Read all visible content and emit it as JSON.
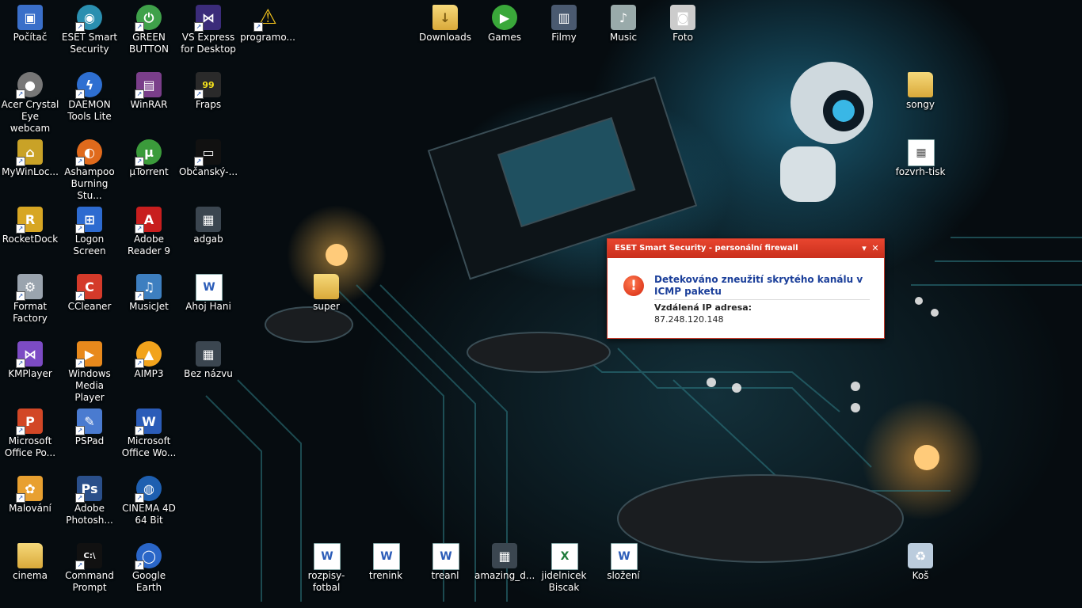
{
  "desktop": {
    "icons": [
      {
        "label": "Počítač",
        "icon": "computer-icon"
      },
      {
        "label": "ESET Smart Security",
        "icon": "eset-icon"
      },
      {
        "label": "GREEN BUTTON",
        "icon": "green-button-icon"
      },
      {
        "label": "VS Express for Desktop",
        "icon": "visual-studio-icon"
      },
      {
        "label": "programo...",
        "icon": "warning-icon"
      },
      {
        "label": "Acer Crystal Eye webcam",
        "icon": "webcam-icon"
      },
      {
        "label": "DAEMON Tools Lite",
        "icon": "daemon-tools-icon"
      },
      {
        "label": "WinRAR",
        "icon": "winrar-icon"
      },
      {
        "label": "Fraps",
        "icon": "fraps-icon"
      },
      {
        "label": "MyWinLoc...",
        "icon": "lock-icon"
      },
      {
        "label": "Ashampoo Burning Stu...",
        "icon": "ashampoo-icon"
      },
      {
        "label": "µTorrent",
        "icon": "utorrent-icon"
      },
      {
        "label": "Občanský-...",
        "icon": "window-icon"
      },
      {
        "label": "RocketDock",
        "icon": "rocketdock-icon"
      },
      {
        "label": "Logon Screen",
        "icon": "logon-screen-icon"
      },
      {
        "label": "Adobe Reader 9",
        "icon": "adobe-reader-icon"
      },
      {
        "label": "adgab",
        "icon": "image-icon"
      },
      {
        "label": "Format Factory",
        "icon": "format-factory-icon"
      },
      {
        "label": "CCleaner",
        "icon": "ccleaner-icon"
      },
      {
        "label": "MusicJet",
        "icon": "musicjet-icon"
      },
      {
        "label": "Ahoj Hani",
        "icon": "word-doc-icon"
      },
      {
        "label": "KMPlayer",
        "icon": "kmplayer-icon"
      },
      {
        "label": "Windows Media Player",
        "icon": "media-player-icon"
      },
      {
        "label": "AIMP3",
        "icon": "aimp-icon"
      },
      {
        "label": "Bez názvu",
        "icon": "image-icon"
      },
      {
        "label": "Microsoft Office Po...",
        "icon": "powerpoint-icon"
      },
      {
        "label": "PSPad",
        "icon": "pspad-icon"
      },
      {
        "label": "Microsoft Office Wo...",
        "icon": "word-icon"
      },
      {
        "label": "Malování",
        "icon": "paint-icon"
      },
      {
        "label": "Adobe Photosh...",
        "icon": "photoshop-icon"
      },
      {
        "label": "CINEMA 4D 64 Bit",
        "icon": "cinema4d-icon"
      },
      {
        "label": "cinema",
        "icon": "folder-icon"
      },
      {
        "label": "Command Prompt",
        "icon": "command-prompt-icon"
      },
      {
        "label": "Google Earth",
        "icon": "google-earth-icon"
      },
      {
        "label": "Downloads",
        "icon": "downloads-folder-icon"
      },
      {
        "label": "Games",
        "icon": "games-icon"
      },
      {
        "label": "Filmy",
        "icon": "film-icon"
      },
      {
        "label": "Music",
        "icon": "music-icon"
      },
      {
        "label": "Foto",
        "icon": "camera-icon"
      },
      {
        "label": "songy",
        "icon": "folder-icon"
      },
      {
        "label": "fozvrh-tisk",
        "icon": "spreadsheet-icon"
      },
      {
        "label": "super",
        "icon": "folder-icon"
      },
      {
        "label": "rozpisy-fotbal",
        "icon": "word-doc-icon"
      },
      {
        "label": "trenink",
        "icon": "word-doc-icon"
      },
      {
        "label": "treanl",
        "icon": "word-doc-icon"
      },
      {
        "label": "amazing_d...",
        "icon": "image-icon"
      },
      {
        "label": "jidelnicek Biscak",
        "icon": "excel-doc-icon"
      },
      {
        "label": "složení",
        "icon": "word-doc-icon"
      },
      {
        "label": "Koš",
        "icon": "recycle-bin-icon"
      }
    ]
  },
  "dialog": {
    "title": "ESET Smart Security - personální firewall",
    "heading": "Detekováno zneužití skrytého kanálu v ICMP paketu",
    "ip_label": "Vzdálená IP adresa:",
    "ip_value": "87.248.120.148",
    "menu_glyph": "▾",
    "close_glyph": "✕",
    "alert_glyph": "!"
  },
  "colors": {
    "dialog_title": "#d13a24",
    "dialog_heading": "#1b3f9a",
    "desktop_bg": "#05090c"
  }
}
